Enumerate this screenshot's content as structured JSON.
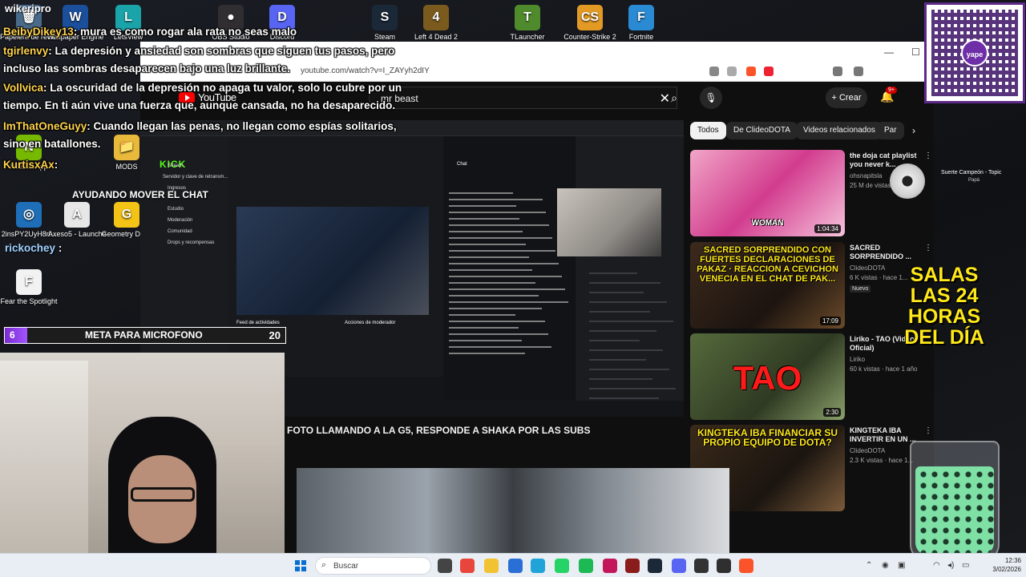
{
  "desktop": {
    "icons": [
      {
        "label": "Papelera de reciclaje",
        "glyph": "🗑",
        "color": "#4a6a8a"
      },
      {
        "label": "Wallpaper Engine",
        "glyph": "W",
        "color": "#1b4f9c"
      },
      {
        "label": "LetsView",
        "glyph": "L",
        "color": "#1aa3a8"
      },
      {
        "label": "OBS Studio",
        "glyph": "●",
        "color": "#302e31"
      },
      {
        "label": "Discord",
        "glyph": "D",
        "color": "#5865f2"
      },
      {
        "label": "Steam",
        "glyph": "S",
        "color": "#1b2838"
      },
      {
        "label": "Left 4 Dead 2",
        "glyph": "4",
        "color": "#7b5a1e"
      },
      {
        "label": "TLauncher",
        "glyph": "T",
        "color": "#4f8a2c"
      },
      {
        "label": "Counter-Strike 2",
        "glyph": "CS",
        "color": "#e29a24"
      },
      {
        "label": "Fortnite",
        "glyph": "F",
        "color": "#2a8ad4"
      },
      {
        "label": "NVIDIA App",
        "glyph": "N",
        "color": "#76b900"
      },
      {
        "label": "MODS",
        "glyph": "📁",
        "color": "#e8b93a"
      },
      {
        "label": "2insPY2UyH8ri...",
        "glyph": "◎",
        "color": "#1e6fb8"
      },
      {
        "label": "Axeso5 - Launcher",
        "glyph": "A",
        "color": "#e7e7e7"
      },
      {
        "label": "Geometry Dash",
        "glyph": "G",
        "color": "#f3c316"
      },
      {
        "label": "Fear the Spotlight",
        "glyph": "F",
        "color": "#f2f2f2"
      }
    ]
  },
  "chat_overlay": [
    {
      "user": "BeibyDikey13",
      "msg": ": mura es como rogar ala rata no seas malo"
    },
    {
      "user": "tgirlenvy",
      "msg": ": La depresión y ansiedad son sombras que siguen tus pasos, pero"
    },
    {
      "user": "",
      "msg": "incluso las sombras desaparecen bajo una luz brillante."
    },
    {
      "user": "Vollvica",
      "msg": ": La oscuridad de la depresión no apaga tu valor, solo lo cubre por un"
    },
    {
      "user": "",
      "msg": "tiempo. En ti aún vive una fuerza que, aunque cansada, no ha desaparecido."
    },
    {
      "user": "ImThatOneGuyy",
      "msg": ": Cuando llegan las penas, no llegan como espías solitarios,"
    },
    {
      "user": "",
      "msg": "sino en batallones."
    },
    {
      "user": "KurtisxAx",
      "msg": ":"
    }
  ],
  "chat_user_extra": {
    "user": "rickochey",
    "msg": ":"
  },
  "overlay_top": {
    "wiki": "wikeripro"
  },
  "ayudando": "AYUDANDO MOVER EL CHAT",
  "meta": {
    "current": "6",
    "label": "META PARA MICROFONO",
    "goal": "20"
  },
  "browser": {
    "url": "youtube.com/watch?v=I_ZAYyh2dIY",
    "brand": "YouTube",
    "search_value": "mr beast",
    "create_label": "Crear",
    "notif_count": "9+",
    "video_title": "FOTO LLAMANDO A LA G5, RESPONDE A SHAKA POR LAS SUBS",
    "chips": [
      "Todos",
      "De ClideoDOTA",
      "Videos relacionados",
      "Par"
    ],
    "recs": [
      {
        "title": "the doja cat playlist you never k...",
        "channel": "ohsnapitsla",
        "meta": "25 M de vistas",
        "duration": "1:04:34",
        "thumb_text": "WOMAN",
        "badge": ""
      },
      {
        "title": "SACRED SORPRENDIDO ...",
        "channel": "ClideoDOTA",
        "meta": "6 K vistas · hace 1...",
        "duration": "17:09",
        "thumb_text": "SACRED SORPRENDIDO CON FUERTES DECLARACIONES DE PAKAZ · REACCION A CEVICHON VENECIA EN EL CHAT DE PAK...",
        "badge": "Nuevo"
      },
      {
        "title": "Liriko - TAO (Video Oficial)",
        "channel": "Liriko",
        "meta": "60 k vistas · hace 1 año",
        "duration": "2:30",
        "thumb_text": "TAO",
        "badge": ""
      },
      {
        "title": "KINGTEKA IBA INVERTIR EN UN ...",
        "channel": "ClideoDOTA",
        "meta": "2.3 K vistas · hace 1...",
        "duration": "",
        "thumb_text": "KINGTEKA IBA FINANCIAR SU PROPIO EQUIPO DE DOTA?",
        "badge": ""
      }
    ]
  },
  "inner_screen": {
    "brand": "KICK",
    "nav": [
      "Stream",
      "Servidor y clave de retransm...",
      "Ingresos",
      "Estudio",
      "Moderación",
      "Comunidad",
      "Drops y recompensas"
    ],
    "chat_title": "Chat",
    "feed_title": "Feed de actividades",
    "mod_title": "Acciones de moderador"
  },
  "salas": "SALAS LAS 24 HORAS DEL DÍA",
  "song": {
    "title": "Suerte Campeón - Topic",
    "artist": "Papá"
  },
  "qr": {
    "label": "yape"
  },
  "taskbar": {
    "search_label": "Buscar",
    "time": "12:36",
    "date": "3/02/2026"
  }
}
